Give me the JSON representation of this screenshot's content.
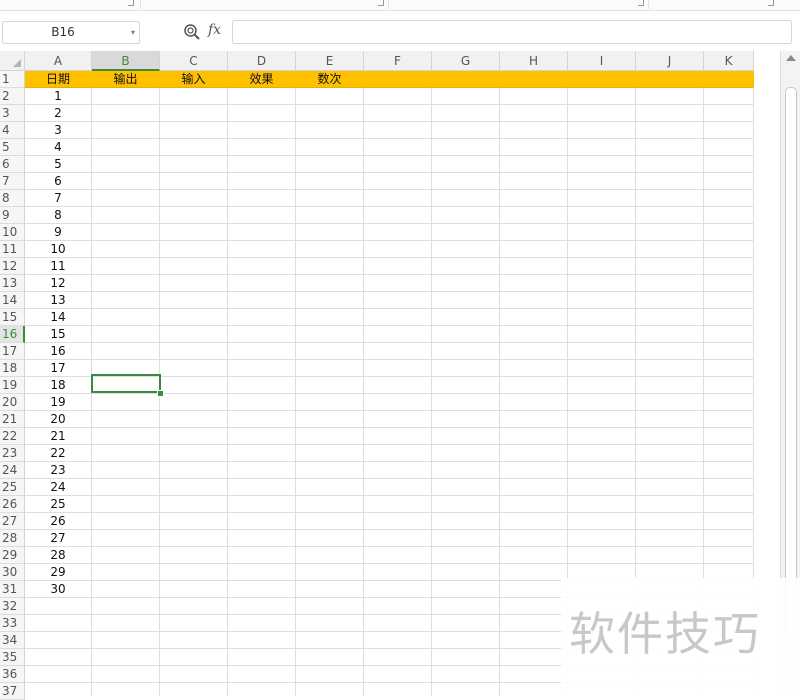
{
  "formula_bar": {
    "name_box": "B16",
    "name_box_arrow": "▾",
    "fx_label": "fx",
    "formula_value": ""
  },
  "grid": {
    "columns": [
      "A",
      "B",
      "C",
      "D",
      "E",
      "F",
      "G",
      "H",
      "I",
      "J",
      "K"
    ],
    "active_column": "B",
    "rows": [
      "1",
      "2",
      "3",
      "4",
      "5",
      "6",
      "7",
      "8",
      "9",
      "10",
      "11",
      "12",
      "13",
      "14",
      "15",
      "16",
      "17",
      "18",
      "19",
      "20",
      "21",
      "22",
      "23",
      "24",
      "25",
      "26",
      "27",
      "28",
      "29",
      "30",
      "31",
      "32",
      "33",
      "34",
      "35",
      "36",
      "37"
    ],
    "active_row": "16",
    "header_row": [
      "日期",
      "输出",
      "输入",
      "效果",
      "数次"
    ],
    "date_values": [
      "1",
      "2",
      "3",
      "4",
      "5",
      "6",
      "7",
      "8",
      "9",
      "10",
      "11",
      "12",
      "13",
      "14",
      "15",
      "16",
      "17",
      "18",
      "19",
      "20",
      "21",
      "22",
      "23",
      "24",
      "25",
      "26",
      "27",
      "28",
      "29",
      "30"
    ],
    "header_fill_color": "#ffc000",
    "selection_color": "#3c8a3c"
  },
  "watermark": {
    "text": "软件技巧"
  }
}
